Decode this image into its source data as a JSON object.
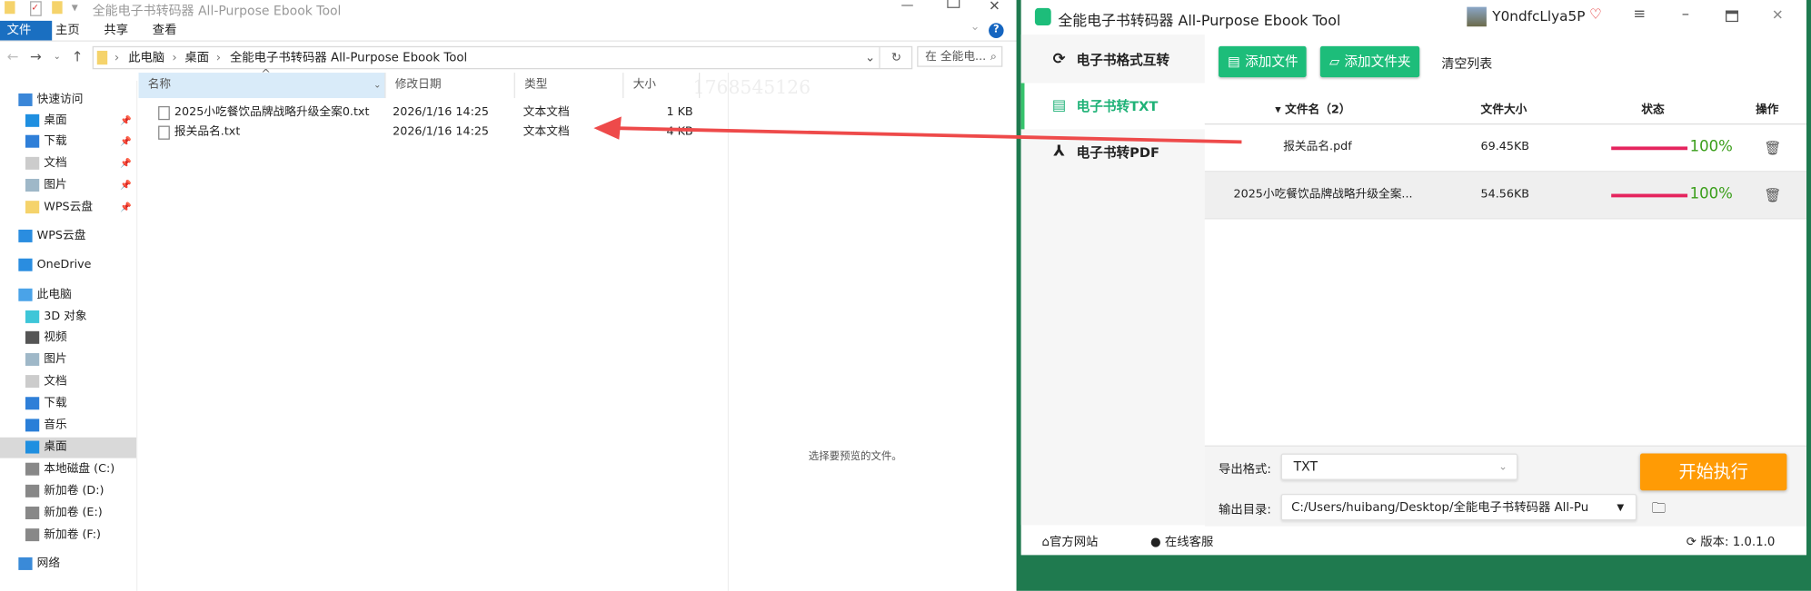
{
  "explorer": {
    "title": "全能电子书转码器 All-Purpose Ebook Tool",
    "ribbon_tabs": [
      "文件",
      "主页",
      "共享",
      "查看"
    ],
    "breadcrumb": [
      "此电脑",
      "桌面",
      "全能电子书转码器 All-Purpose Ebook Tool"
    ],
    "search_placeholder": "在 全能电...",
    "watermark": "1768545126",
    "nav": [
      {
        "label": "快速访问",
        "icon": "star-icon",
        "pinned": false
      },
      {
        "label": "桌面",
        "icon": "desktop-icon",
        "pinned": true
      },
      {
        "label": "下载",
        "icon": "download-icon",
        "pinned": true
      },
      {
        "label": "文档",
        "icon": "document-icon",
        "pinned": true
      },
      {
        "label": "图片",
        "icon": "picture-icon",
        "pinned": true
      },
      {
        "label": "WPS云盘",
        "icon": "folder-icon",
        "pinned": true
      },
      {
        "label": "WPS云盘",
        "icon": "cloud-icon",
        "pinned": false
      },
      {
        "label": "OneDrive",
        "icon": "cloud-icon",
        "pinned": false
      },
      {
        "label": "此电脑",
        "icon": "computer-icon",
        "pinned": false
      },
      {
        "label": "3D 对象",
        "icon": "cube-icon",
        "pinned": false
      },
      {
        "label": "视频",
        "icon": "video-icon",
        "pinned": false
      },
      {
        "label": "图片",
        "icon": "picture-icon",
        "pinned": false
      },
      {
        "label": "文档",
        "icon": "document-icon",
        "pinned": false
      },
      {
        "label": "下载",
        "icon": "download-icon",
        "pinned": false
      },
      {
        "label": "音乐",
        "icon": "music-icon",
        "pinned": false
      },
      {
        "label": "桌面",
        "icon": "desktop-icon",
        "pinned": false,
        "selected": true
      },
      {
        "label": "本地磁盘 (C:)",
        "icon": "drive-icon",
        "pinned": false
      },
      {
        "label": "新加卷 (D:)",
        "icon": "drive-icon",
        "pinned": false
      },
      {
        "label": "新加卷 (E:)",
        "icon": "drive-icon",
        "pinned": false
      },
      {
        "label": "新加卷 (F:)",
        "icon": "drive-icon",
        "pinned": false
      },
      {
        "label": "网络",
        "icon": "network-icon",
        "pinned": false
      }
    ],
    "columns": [
      "名称",
      "修改日期",
      "类型",
      "大小"
    ],
    "files": [
      {
        "name": "2025小吃餐饮品牌战略升级全案0.txt",
        "date": "2026/1/16 14:25",
        "type": "文本文档",
        "size": "1 KB"
      },
      {
        "name": "报关品名.txt",
        "date": "2026/1/16 14:25",
        "type": "文本文档",
        "size": "4 KB"
      }
    ],
    "preview_text": "选择要预览的文件。"
  },
  "app": {
    "title": "全能电子书转码器 All-Purpose Ebook Tool",
    "username": "Y0ndfcLlya5P",
    "accent": "#1dbd7a",
    "sidebar": [
      {
        "label": "电子书格式互转",
        "icon": "refresh-icon"
      },
      {
        "label": "电子书转TXT",
        "icon": "txt-document-icon",
        "active": true
      },
      {
        "label": "电子书转PDF",
        "icon": "pdf-icon"
      }
    ],
    "toolbar": {
      "add_file": "添加文件",
      "add_folder": "添加文件夹",
      "clear": "清空列表"
    },
    "table": {
      "headers": [
        "文件名（2）",
        "文件大小",
        "状态",
        "操作"
      ],
      "rows": [
        {
          "name": "报关品名.pdf",
          "size": "69.45KB",
          "progress": 100,
          "status": "100%"
        },
        {
          "name": "2025小吃餐饮品牌战略升级全案...",
          "size": "54.56KB",
          "progress": 100,
          "status": "100%"
        }
      ]
    },
    "export_format_label": "导出格式:",
    "export_format": "TXT",
    "output_dir_label": "输出目录:",
    "output_dir": "C:/Users/huibang/Desktop/全能电子书转码器 All-Pu",
    "start_button": "开始执行",
    "footer": {
      "website": "官方网站",
      "support": "在线客服",
      "version": "版本: 1.0.1.0"
    }
  }
}
